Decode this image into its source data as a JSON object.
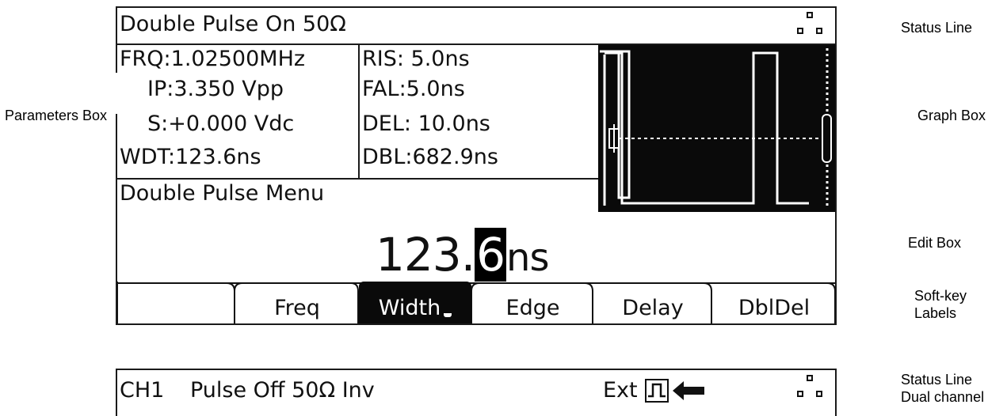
{
  "status": {
    "text": "Double Pulse On 50Ω"
  },
  "params": {
    "frq": "FRQ:1.02500MHz",
    "amp": "IP:3.350 Vpp",
    "ofs": "S:+0.000 Vdc",
    "wdt": "WDT:123.6ns",
    "ris": "RIS:  5.0ns",
    "fal": "FAL:5.0ns",
    "del": "DEL: 10.0ns",
    "dbl": "DBL:682.9ns"
  },
  "menu": {
    "title": "Double Pulse Menu"
  },
  "edit": {
    "value_prefix": "123.",
    "cursor_digit": "6",
    "unit": "ns"
  },
  "softkeys": [
    {
      "label": ""
    },
    {
      "label": "Freq"
    },
    {
      "label": "Width"
    },
    {
      "label": "Edge"
    },
    {
      "label": "Delay"
    },
    {
      "label": "DblDel"
    }
  ],
  "status2": {
    "channel": "CH1",
    "text": "Pulse Off 50Ω Inv",
    "ext": "Ext"
  },
  "annotations": {
    "status_line": "Status Line",
    "parameters_box": "Parameters Box",
    "graph_box": "Graph Box",
    "edit_box": "Edit Box",
    "softkey_line1": "Soft-key",
    "softkey_line2": "Labels",
    "status_dual_line1": "Status Line",
    "status_dual_line2": "Dual channel"
  }
}
